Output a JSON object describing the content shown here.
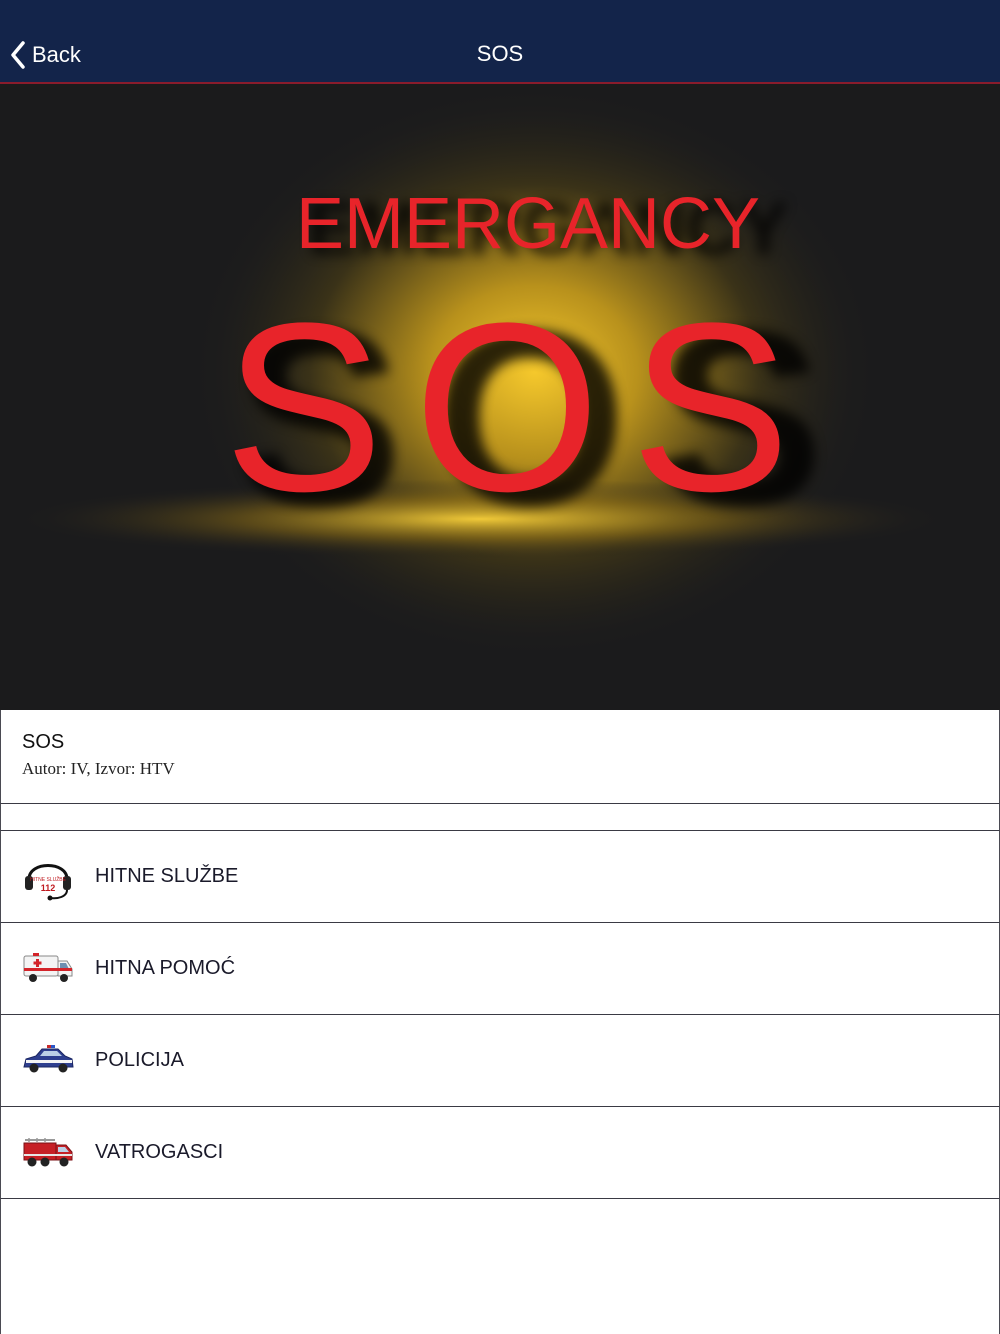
{
  "navbar": {
    "back_label": "Back",
    "title": "SOS",
    "background": "#13244a",
    "accent": "#8a1c2c"
  },
  "hero": {
    "line1": "EMERGANCY",
    "line2": "SOS",
    "text_color": "#e8242a",
    "glow_color": "#f2c230"
  },
  "info": {
    "title": "SOS",
    "subtitle": "Autor: IV, Izvor: HTV"
  },
  "list": [
    {
      "label": "HITNE SLUŽBE",
      "icon": "headset-112-icon",
      "icon_text_top": "HITNE SLUŽBE",
      "icon_text_num": "112"
    },
    {
      "label": "HITNA POMOĆ",
      "icon": "ambulance-icon"
    },
    {
      "label": "POLICIJA",
      "icon": "police-car-icon"
    },
    {
      "label": "VATROGASCI",
      "icon": "fire-truck-icon"
    }
  ]
}
